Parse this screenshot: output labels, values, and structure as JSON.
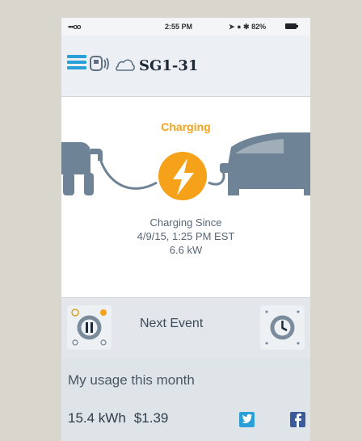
{
  "status_bar": {
    "carrier": "•••oo",
    "time": "2:55 PM",
    "battery": "82%"
  },
  "header": {
    "title": "SG1-31"
  },
  "charging": {
    "status": "Charging",
    "since_label": "Charging Since",
    "since_time": "4/9/15, 1:25 PM EST",
    "power": "6.6 kW"
  },
  "events": {
    "title": "Next Event"
  },
  "usage": {
    "title": "My usage this month",
    "energy": "15.4 kWh",
    "cost": "$1.39"
  },
  "colors": {
    "accent_blue": "#2a9fd8",
    "charging_orange": "#f5a21a",
    "illustration_gray": "#6e8396"
  }
}
